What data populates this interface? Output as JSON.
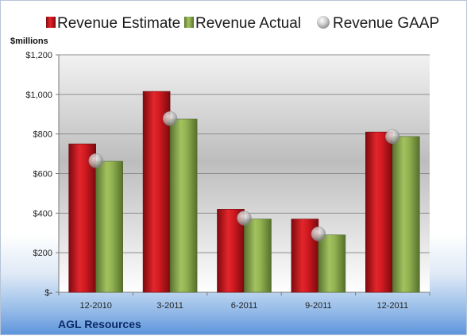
{
  "chart_data": {
    "type": "bar",
    "categories": [
      "12-2010",
      "3-2011",
      "6-2011",
      "9-2011",
      "12-2011"
    ],
    "series": [
      {
        "name": "Revenue Estimate",
        "kind": "bar",
        "color": "#c0161c",
        "values": [
          750,
          1015,
          420,
          370,
          810
        ]
      },
      {
        "name": "Revenue Actual",
        "kind": "bar",
        "color": "#8aa84a",
        "values": [
          662,
          875,
          370,
          290,
          787
        ]
      },
      {
        "name": "Revenue GAAP",
        "kind": "marker",
        "color": "#b9b9b9",
        "values": [
          665,
          878,
          375,
          295,
          787
        ]
      }
    ],
    "ylabel": "$millions",
    "ylim": [
      0,
      1200
    ],
    "yticks": [
      0,
      200,
      400,
      600,
      800,
      1000,
      1200
    ],
    "ytick_labels": [
      "$-",
      "$200",
      "$400",
      "$600",
      "$800",
      "$1,000",
      "$1,200"
    ],
    "grid": true,
    "legend_position": "top",
    "company": "AGL Resources"
  }
}
